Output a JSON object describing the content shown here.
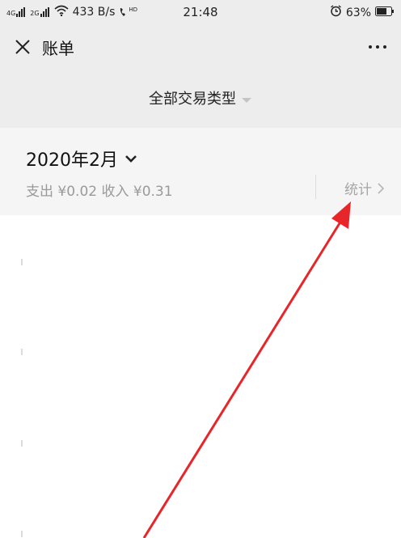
{
  "status_bar": {
    "network_1": "4G",
    "network_2": "2G",
    "speed": "433 B/s",
    "hd": "HD",
    "time": "21:48",
    "battery": "63%"
  },
  "nav": {
    "title": "账单"
  },
  "filter": {
    "label": "全部交易类型"
  },
  "month": {
    "title": "2020年2月",
    "expense_label": "支出",
    "expense_value": "¥0.02",
    "income_label": "收入",
    "income_value": "¥0.31",
    "stats_label": "统计"
  },
  "annotation": {
    "arrow_color": "#e8262a"
  },
  "colors": {
    "header_bg": "#ededed",
    "card_bg": "#f5f5f5"
  }
}
